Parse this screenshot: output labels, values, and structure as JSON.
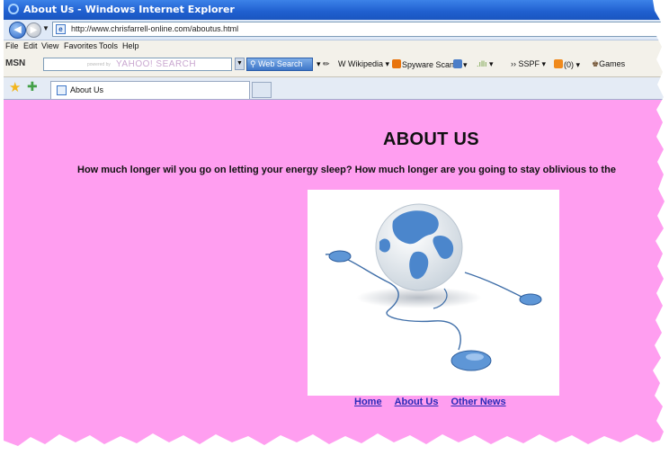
{
  "window": {
    "title": "About Us - Windows Internet Explorer",
    "address": "http://www.chrisfarrell-online.com/aboutus.html"
  },
  "menu": [
    "File",
    "Edit",
    "View",
    "Favorites",
    "Tools",
    "Help"
  ],
  "toolbar": {
    "msn_label": "MSN",
    "search_brand": "YAHOO! SEARCH",
    "search_powered": "powered by",
    "web_search_label": "Web Search",
    "wikipedia_label": "Wikipedia",
    "spyware_label": "Spyware Scan",
    "sspf_label": "SSPF",
    "rss_count": "(0)",
    "games_label": "Games"
  },
  "tab": {
    "label": "About Us"
  },
  "page": {
    "heading": "ABOUT US",
    "intro": "How much longer wil you go on letting your energy sleep?  How much longer are you going to stay oblivious to the",
    "links": [
      "Home",
      "About Us",
      "Other News"
    ]
  }
}
